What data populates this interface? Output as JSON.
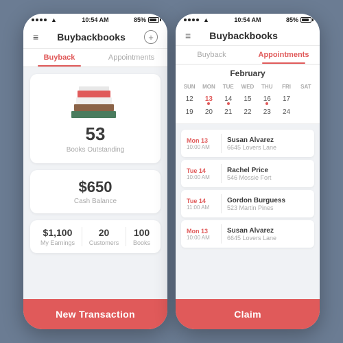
{
  "phones": {
    "left": {
      "statusBar": {
        "time": "10:54 AM",
        "battery": "85%"
      },
      "title": "Buybackbooks",
      "tabs": [
        {
          "label": "Buyback",
          "active": true
        },
        {
          "label": "Appointments",
          "active": false
        }
      ],
      "booksCard": {
        "count": "53",
        "label": "Books Outstanding"
      },
      "balanceCard": {
        "amount": "$650",
        "label": "Cash Balance"
      },
      "stats": [
        {
          "value": "$1,100",
          "label": "My Earnings"
        },
        {
          "value": "20",
          "label": "Customers"
        },
        {
          "value": "100",
          "label": "Books"
        }
      ],
      "bottomBtn": "New Transaction"
    },
    "right": {
      "statusBar": {
        "time": "10:54 AM",
        "battery": "85%"
      },
      "title": "Buybackbooks",
      "tabs": [
        {
          "label": "Buyback",
          "active": false
        },
        {
          "label": "Appointments",
          "active": true
        }
      ],
      "calendar": {
        "month": "February",
        "dayNames": [
          "SUN",
          "MON",
          "TUE",
          "WED",
          "THU",
          "FRI",
          "SAT"
        ],
        "weeks": [
          [
            {
              "date": "12",
              "dot": false,
              "highlighted": false
            },
            {
              "date": "13",
              "dot": true,
              "highlighted": true
            },
            {
              "date": "14",
              "dot": true,
              "highlighted": false
            },
            {
              "date": "15",
              "dot": false,
              "highlighted": false
            },
            {
              "date": "16",
              "dot": true,
              "highlighted": false
            },
            {
              "date": "17",
              "dot": false,
              "highlighted": false
            },
            {
              "date": "",
              "dot": false,
              "highlighted": false
            }
          ],
          [
            {
              "date": "19",
              "dot": false,
              "highlighted": false
            },
            {
              "date": "20",
              "dot": false,
              "highlighted": false
            },
            {
              "date": "21",
              "dot": false,
              "highlighted": false
            },
            {
              "date": "22",
              "dot": false,
              "highlighted": false
            },
            {
              "date": "23",
              "dot": false,
              "highlighted": false
            },
            {
              "date": "24",
              "dot": false,
              "highlighted": false
            },
            {
              "date": "",
              "dot": false,
              "highlighted": false
            }
          ]
        ]
      },
      "appointments": [
        {
          "day": "Mon 13",
          "time": "10:00 AM",
          "name": "Susan Alvarez",
          "address": "6645 Lovers Lane"
        },
        {
          "day": "Tue 14",
          "time": "10:00 AM",
          "name": "Rachel Price",
          "address": "546 Mossie Fort"
        },
        {
          "day": "Tue 14",
          "time": "11:00 AM",
          "name": "Gordon Burguess",
          "address": "523 Martin Pines"
        },
        {
          "day": "Mon 13",
          "time": "10:00 AM",
          "name": "Susan Alvarez",
          "address": "6645 Lovers Lane"
        }
      ],
      "bottomBtn": "Claim"
    }
  }
}
